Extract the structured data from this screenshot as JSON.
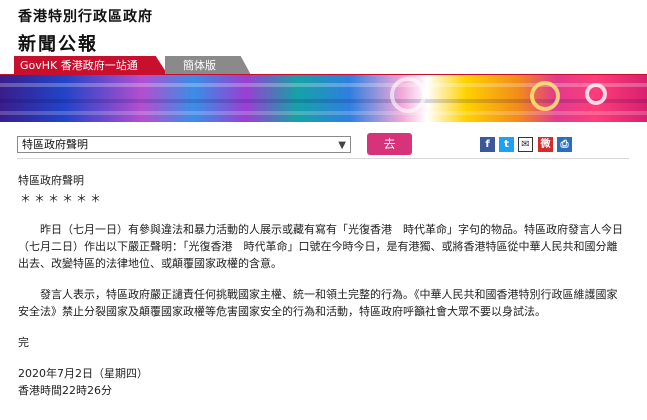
{
  "header": {
    "gov_title": "香港特別行政區政府",
    "site_title": "新聞公報"
  },
  "tabs": {
    "govhk": "GovHK 香港政府一站通",
    "simplified": "簡体版"
  },
  "toolbar": {
    "select_value": "特區政府聲明",
    "go_label": "去",
    "share": {
      "facebook": "f",
      "twitter": "t",
      "email": "✉",
      "weibo": "微",
      "print": "⎙"
    }
  },
  "article": {
    "heading": "特區政府聲明",
    "stars": "＊＊＊＊＊＊",
    "para1": "昨日（七月一日）有參與違法和暴力活動的人展示或藏有寫有「光復香港　時代革命」字句的物品。特區政府發言人今日（七月二日）作出以下嚴正聲明：「光復香港　時代革命」口號在今時今日，是有港獨、或將香港特區從中華人民共和國分離出去、改變特區的法律地位、或顛覆國家政權的含意。",
    "para2": "發言人表示，特區政府嚴正譴責任何挑戰國家主權、統一和領土完整的行為。《中華人民共和國香港特別行政區維護國家安全法》禁止分裂國家及顛覆國家政權等危害國家安全的行為和活動，特區政府呼籲社會大眾不要以身試法。",
    "end": "完",
    "date": "2020年7月2日（星期四）",
    "time": "香港時間22時26分"
  },
  "colors": {
    "brand_red": "#c8102e",
    "go_button": "#d6337a",
    "tab_grey": "#8a8a8a"
  }
}
